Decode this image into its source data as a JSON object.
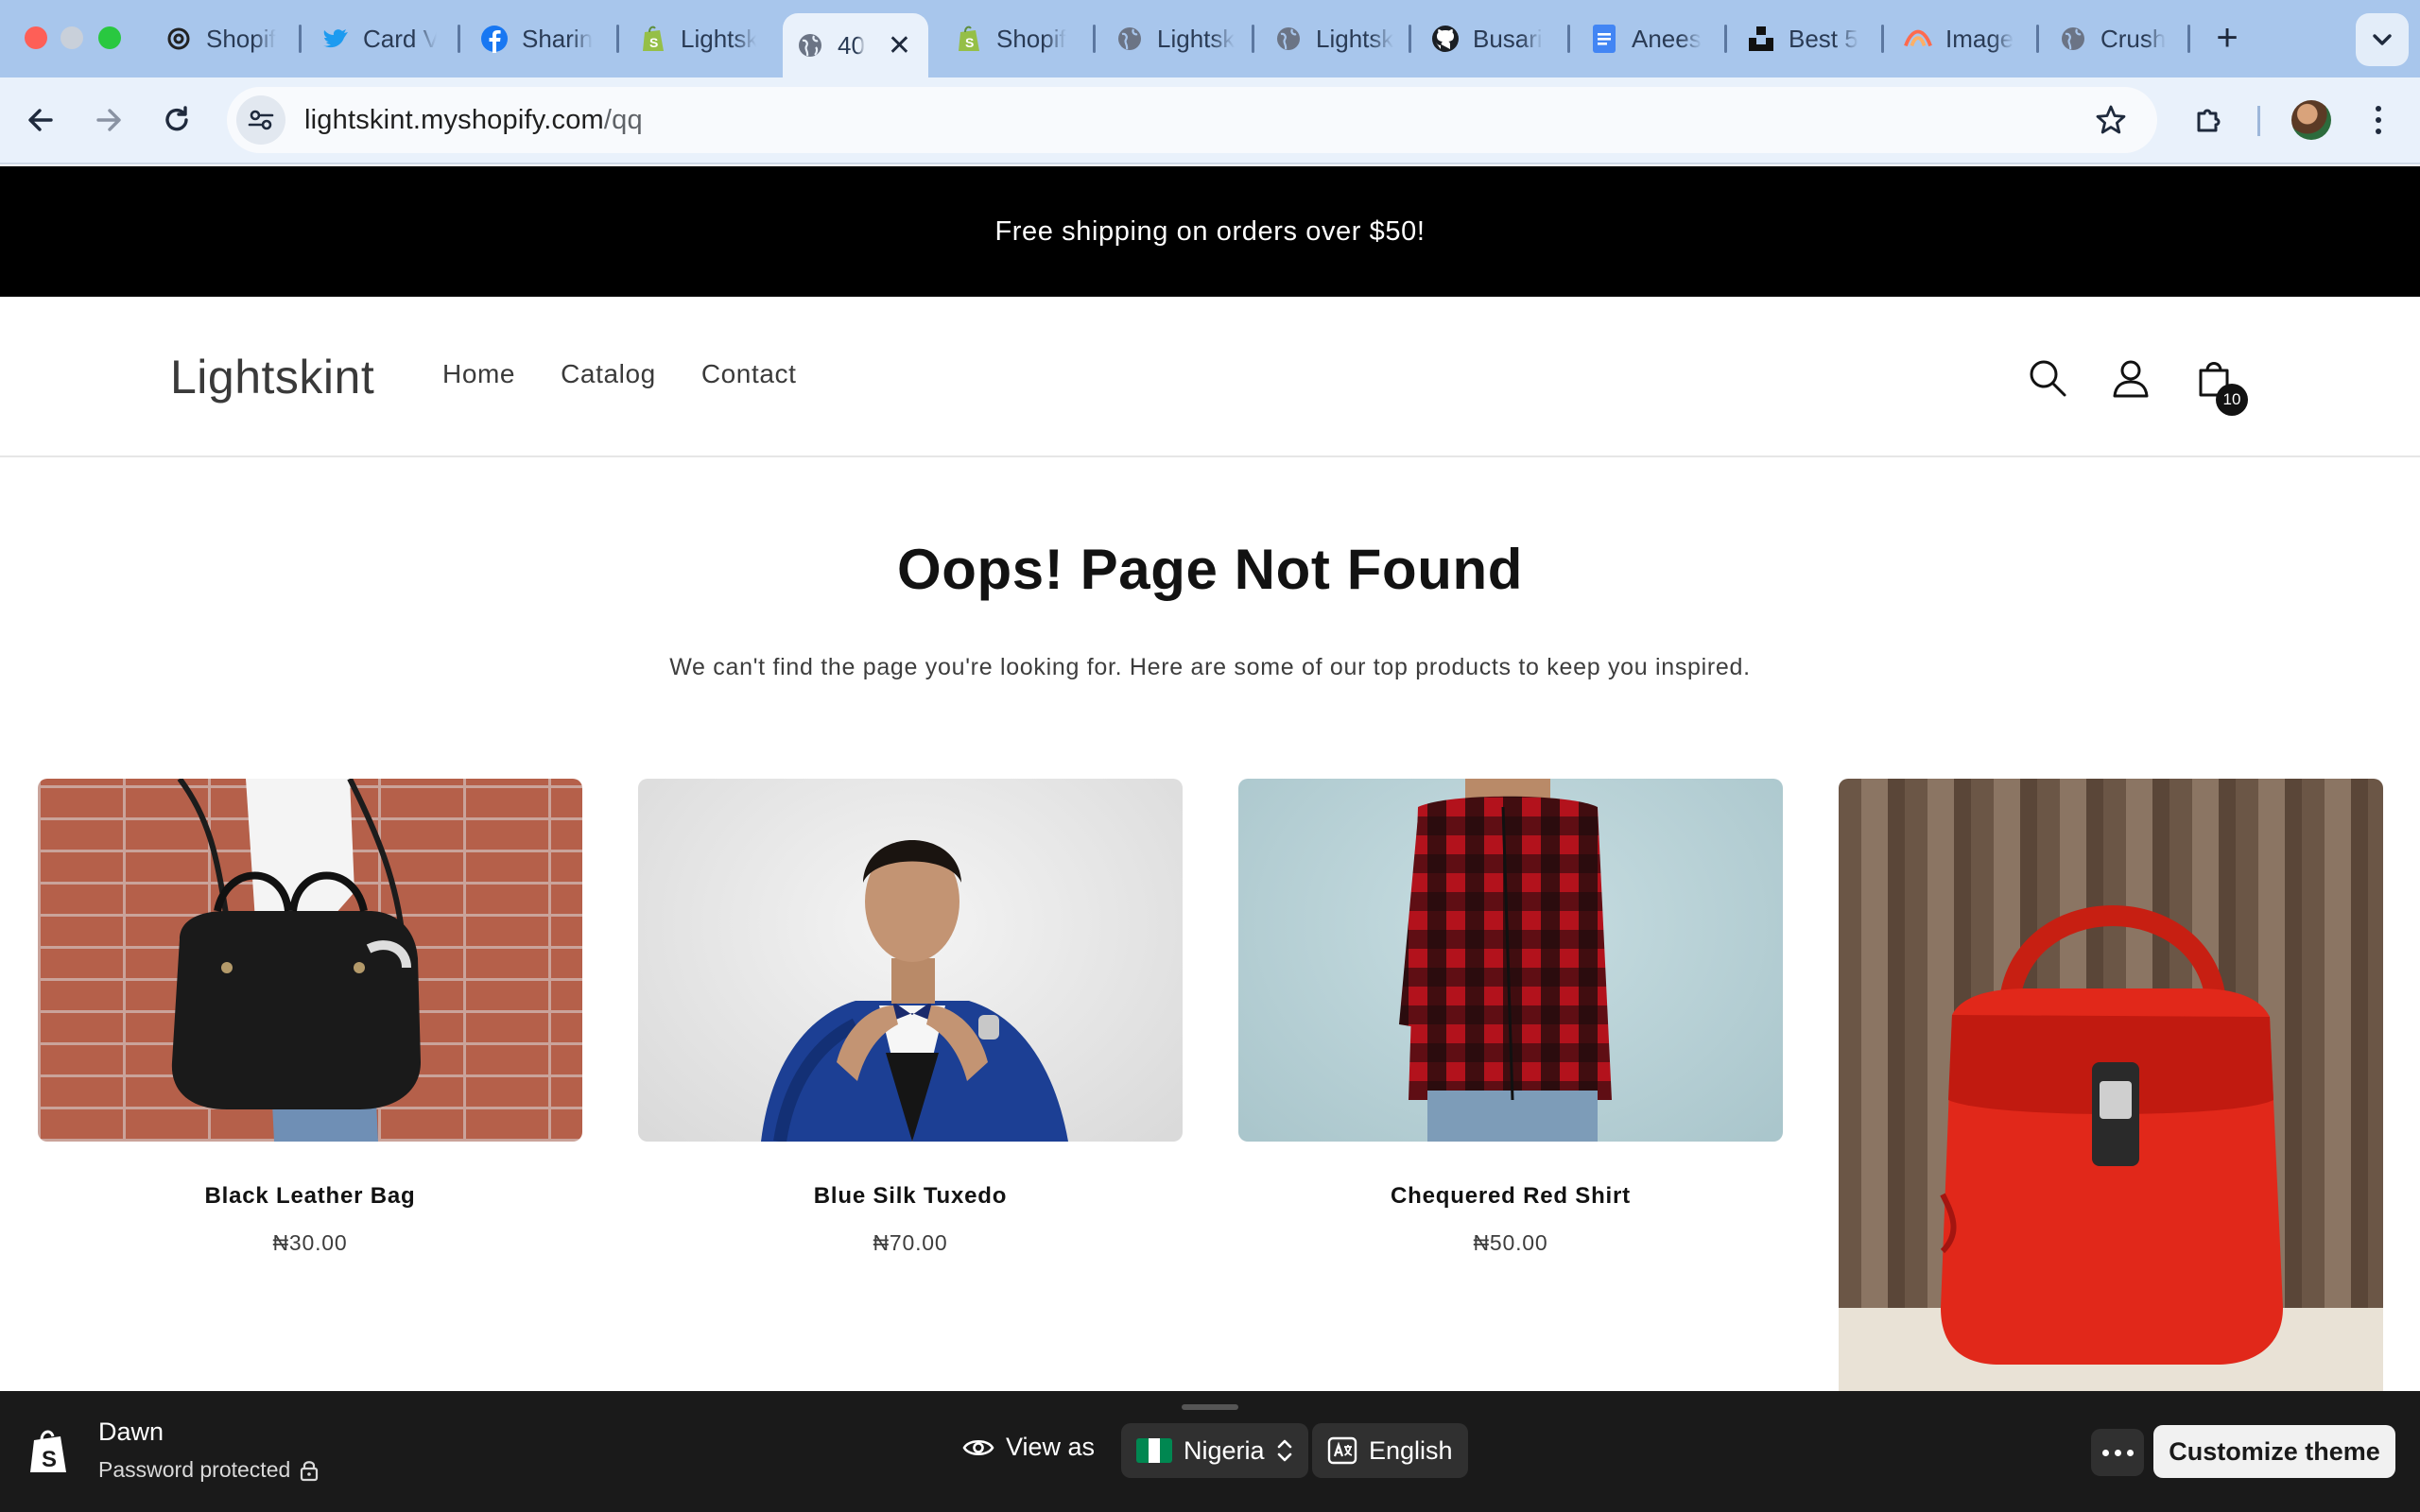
{
  "browser": {
    "tabs": [
      {
        "label": "Shopif",
        "icon": "openai-icon"
      },
      {
        "label": "Card V",
        "icon": "twitter-icon"
      },
      {
        "label": "Sharin",
        "icon": "facebook-icon"
      },
      {
        "label": "Lightsk",
        "icon": "shopify-icon"
      },
      {
        "label": "40",
        "icon": "globe-icon",
        "active": true
      },
      {
        "label": "Shopif",
        "icon": "shopify-icon"
      },
      {
        "label": "Lightsk",
        "icon": "globe-icon"
      },
      {
        "label": "Lightsk",
        "icon": "globe-icon"
      },
      {
        "label": "Busari",
        "icon": "github-icon"
      },
      {
        "label": "Anees",
        "icon": "docs-icon"
      },
      {
        "label": "Best 5",
        "icon": "unsplash-icon"
      },
      {
        "label": "Image",
        "icon": "image-icon"
      },
      {
        "label": "Crush",
        "icon": "globe-icon"
      }
    ],
    "url_host": "lightskint.myshopify.com",
    "url_path": "/qq"
  },
  "store": {
    "announcement": "Free shipping on orders over $50!",
    "logo": "Lightskint",
    "nav": [
      "Home",
      "Catalog",
      "Contact"
    ],
    "cart_count": "10",
    "error_title": "Oops! Page Not Found",
    "error_subtitle": "We can't find the page you're looking for. Here are some of our top products to keep you inspired.",
    "products": [
      {
        "name": "Black Leather Bag",
        "price": "₦30.00"
      },
      {
        "name": "Blue Silk Tuxedo",
        "price": "₦70.00"
      },
      {
        "name": "Chequered Red Shirt",
        "price": "₦50.00"
      },
      {
        "name": "",
        "price": ""
      }
    ]
  },
  "preview_bar": {
    "theme": "Dawn",
    "status": "Password protected",
    "view_as": "View as",
    "country": "Nigeria",
    "language": "English",
    "customize": "Customize theme"
  },
  "colors": {
    "tab_bar": "#a8c6ec",
    "announcement_bg": "#000000",
    "preview_bar_bg": "#1a1a1a",
    "flag_green": "#008751"
  }
}
